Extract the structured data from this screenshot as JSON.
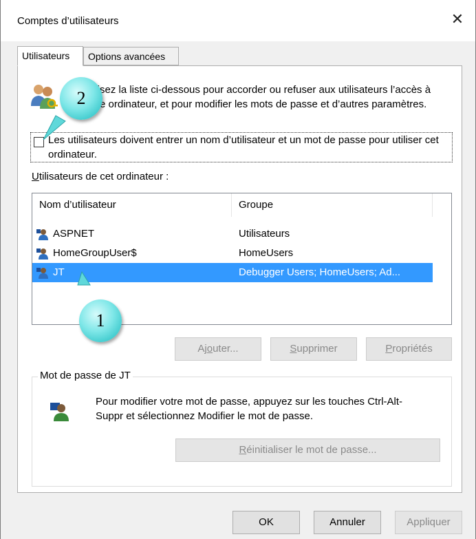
{
  "window": {
    "title": "Comptes d’utilisateurs",
    "close_icon": "close-icon"
  },
  "tabs": [
    {
      "label": "Utilisateurs",
      "active": true
    },
    {
      "label": "Options avancées",
      "active": false
    }
  ],
  "intro": {
    "text": "Utilisez la liste ci-dessous pour accorder ou refuser aux utilisateurs l’accès à votre ordinateur, et pour modifier les mots de passe et d’autres paramètres."
  },
  "checkbox": {
    "label": "Les utilisateurs doivent entrer un nom d’utilisateur et un mot de passe pour utiliser cet ordinateur.",
    "checked": false
  },
  "list": {
    "label_prefix": "U",
    "label_rest": "tilisateurs de cet ordinateur :",
    "columns": [
      "Nom d’utilisateur",
      "Groupe"
    ],
    "rows": [
      {
        "name": "ASPNET",
        "group": "Utilisateurs",
        "selected": false
      },
      {
        "name": "HomeGroupUser$",
        "group": "HomeUsers",
        "selected": false
      },
      {
        "name": "JT",
        "group": "Debugger Users; HomeUsers; Ad...",
        "selected": true
      }
    ]
  },
  "actions": {
    "add_a": "Aj",
    "add_u": "o",
    "add_b": "uter...",
    "remove_u": "S",
    "remove_b": "upprimer",
    "props_u": "P",
    "props_b": "ropriétés"
  },
  "password": {
    "group_title": "Mot de passe de JT",
    "text": "Pour modifier votre mot de passe, appuyez sur les touches Ctrl-Alt-Suppr et sélectionnez Modifier le mot de passe.",
    "reset_u": "R",
    "reset_b": "éinitialiser le mot de passe..."
  },
  "footer": {
    "ok": "OK",
    "cancel": "Annuler",
    "apply": "Appliquer"
  },
  "callouts": {
    "one": "1",
    "two": "2"
  },
  "colors": {
    "selection": "#3399ff",
    "callout": "#5fd8da"
  }
}
